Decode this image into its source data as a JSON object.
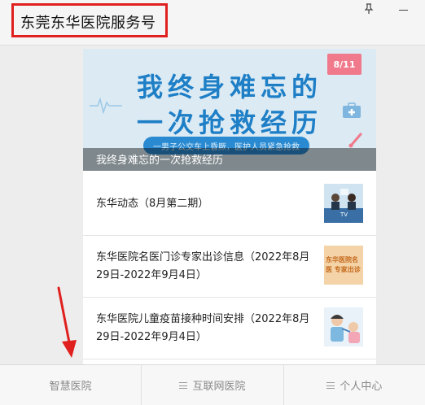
{
  "window": {
    "title": "东莞东华医院服务号",
    "pin_icon": "pin-icon",
    "minimize_icon": "minimize-icon"
  },
  "banner": {
    "date_badge": "8/11",
    "headline_line1": "我终身难忘的",
    "headline_line2": "一次抢救经历",
    "subtitle": "一男子公交车上昏厥，医护人员紧急抢救",
    "caption": "我终身难忘的一次抢救经历"
  },
  "articles": [
    {
      "title": "东华动态（8月第二期）",
      "thumb_text": "TV"
    },
    {
      "title": "东华医院名医门诊专家出诊信息（2022年8月29日-2022年9月4日）",
      "thumb_text": "东华医院名医 专家出诊"
    },
    {
      "title": "东华医院儿童疫苗接种时间安排（2022年8月29日-2022年9月4日）",
      "thumb_text": ""
    }
  ],
  "bottom_nav": [
    {
      "label": "智慧医院",
      "icon": ""
    },
    {
      "label": "互联网医院",
      "icon": "menu-icon"
    },
    {
      "label": "个人中心",
      "icon": "menu-icon"
    }
  ],
  "colors": {
    "annotation_red": "#e0201e",
    "banner_blue": "#1e7fc7",
    "banner_bg": "#dbeaf3"
  }
}
